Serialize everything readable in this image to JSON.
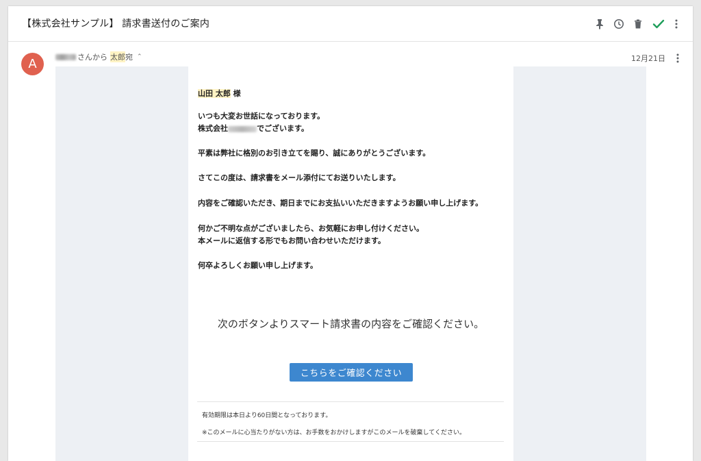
{
  "subject": "【株式会社サンプル】 請求書送付のご案内",
  "icons": [
    "pin-icon",
    "clock-icon",
    "trash-icon",
    "check-icon",
    "more-vert-icon"
  ],
  "colors": {
    "avatar": "#e0614f",
    "button": "#3d87cf",
    "check": "#1e9e5a",
    "highlight": "#fff3c4",
    "email_bg": "#edf0f4"
  },
  "sender": {
    "avatar_letter": "A",
    "from_suffix": "さんから",
    "recipient": "太郎",
    "recipient_suffix": "宛",
    "date": "12月21日"
  },
  "email": {
    "greeting_name": "山田 太郎",
    "greeting_suffix": " 様",
    "line1": "いつも大変お世話になっております。",
    "line2_pre": "株式会社",
    "line2_post": "でございます。",
    "p2": "平素は弊社に格別のお引き立てを賜り、誠にありがとうございます。",
    "p3": "さてこの度は、請求書をメール添付にてお送りいたします。",
    "p4": "内容をご確認いただき、期日までにお支払いいただきますようお願い申し上げます。",
    "p5a": "何かご不明な点がございましたら、お気軽にお申し付けください。",
    "p5b": "本メールに返信する形でもお問い合わせいただけます。",
    "p6": "何卒よろしくお願い申し上げます。",
    "cta_text": "次のボタンよりスマート請求書の内容をご確認ください。",
    "cta_button": "こちらをご確認ください",
    "foot1": "有効期限は本日より60日間となっております。",
    "foot2": "※このメールに心当たりがない方は、お手数をおかけしますがこのメールを破棄してください。"
  }
}
